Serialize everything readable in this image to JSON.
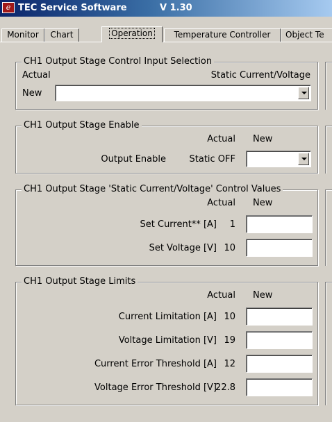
{
  "window": {
    "title": "TEC Service Software",
    "version": "V 1.30",
    "icon_text": "e"
  },
  "tabs": [
    {
      "label": "Monitor"
    },
    {
      "label": "Chart"
    },
    {
      "label": "Operation",
      "active": true
    },
    {
      "label": "Temperature Controller"
    },
    {
      "label": "Object Te"
    }
  ],
  "input_selection": {
    "title": "CH1 Output Stage Control Input Selection",
    "actual_label": "Actual",
    "actual_value": "Static Current/Voltage",
    "new_label": "New",
    "new_value": ""
  },
  "enable": {
    "title": "CH1 Output Stage Enable",
    "col_actual": "Actual",
    "col_new": "New",
    "output_enable_label": "Output Enable",
    "output_enable_actual": "Static OFF",
    "output_enable_new": ""
  },
  "control_values": {
    "title": "CH1 Output Stage 'Static Current/Voltage' Control Values",
    "col_actual": "Actual",
    "col_new": "New",
    "rows": [
      {
        "label": "Set Current** [A]",
        "actual": "1",
        "new": ""
      },
      {
        "label": "Set Voltage   [V]",
        "actual": "10",
        "new": ""
      }
    ]
  },
  "limits": {
    "title": "CH1 Output Stage Limits",
    "col_actual": "Actual",
    "col_new": "New",
    "rows": [
      {
        "label": "Current Limitation [A]",
        "actual": "10",
        "new": ""
      },
      {
        "label": "Voltage Limitation [V]",
        "actual": "19",
        "new": ""
      },
      {
        "label": "Current Error Threshold [A]",
        "actual": "12",
        "new": ""
      },
      {
        "label": "Voltage Error Threshold [V]",
        "actual": "22.8",
        "new": ""
      }
    ]
  }
}
